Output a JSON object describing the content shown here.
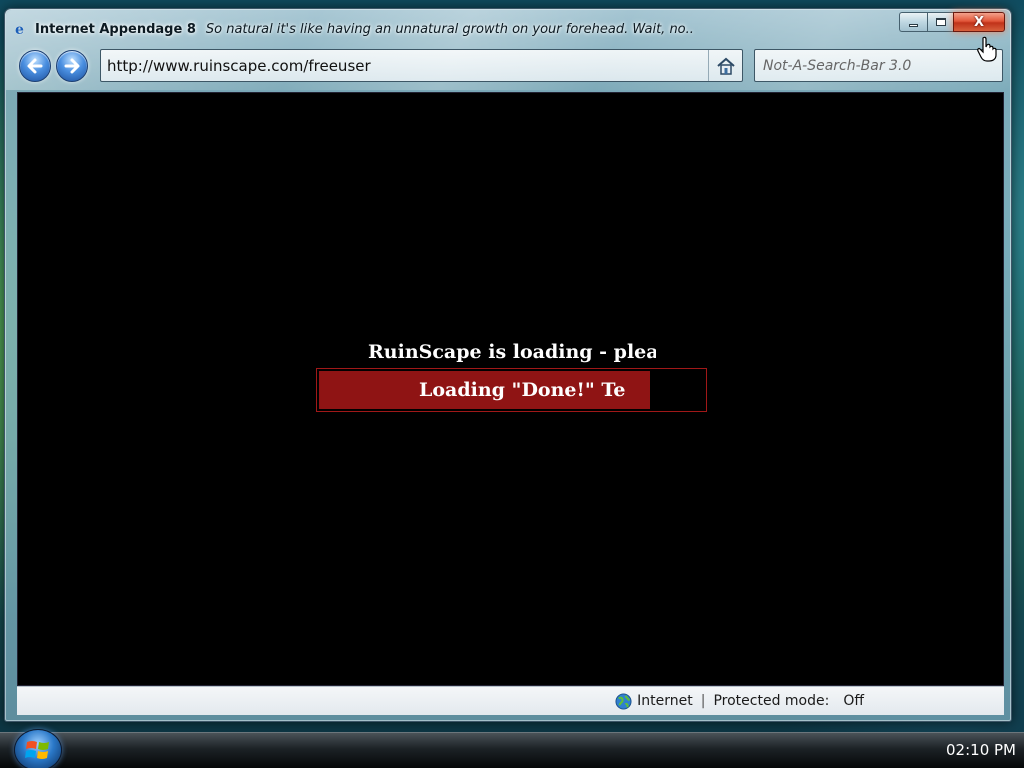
{
  "window": {
    "title": "Internet Appendage 8",
    "tagline": "So natural it's like having an unnatural growth on your forehead.  Wait, no..",
    "close_label": "X"
  },
  "nav": {
    "back_icon": "back-arrow-icon",
    "forward_icon": "forward-arrow-icon",
    "address_url": "http://www.ruinscape.com/freeuser",
    "home_icon": "home-icon",
    "search_placeholder": "Not-A-Search-Bar 3.0"
  },
  "page": {
    "loading_message": "RuinScape is loading - please wa",
    "progress_label": "Loading \"Done!\" Te",
    "progress_fraction": 0.86,
    "accent_color": "#8f1414"
  },
  "status_bar": {
    "zone_icon": "globe-icon",
    "zone": "Internet",
    "separator": "|",
    "protected_mode_label": "Protected mode:",
    "protected_mode_value": "Off"
  },
  "taskbar": {
    "start_icon": "windows-logo-icon",
    "clock": "02:10 PM"
  }
}
